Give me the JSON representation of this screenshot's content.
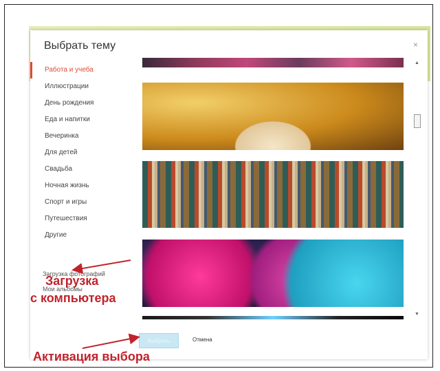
{
  "dialog": {
    "title": "Выбрать тему",
    "close_label": "×"
  },
  "sidebar": {
    "categories": [
      {
        "label": "Работа и учеба",
        "active": true
      },
      {
        "label": "Иллюстрации",
        "active": false
      },
      {
        "label": "День рождения",
        "active": false
      },
      {
        "label": "Еда и напитки",
        "active": false
      },
      {
        "label": "Вечеринка",
        "active": false
      },
      {
        "label": "Для детей",
        "active": false
      },
      {
        "label": "Свадьба",
        "active": false
      },
      {
        "label": "Ночная жизнь",
        "active": false
      },
      {
        "label": "Спорт и игры",
        "active": false
      },
      {
        "label": "Путешествия",
        "active": false
      },
      {
        "label": "Другие",
        "active": false
      }
    ],
    "upload_label": "Загрузка фотографий",
    "albums_label": "Мои альбомы"
  },
  "images": [
    "top-partial-image",
    "open-book-image",
    "paint-brushes-image",
    "lab-flasks-image",
    "bottom-partial-image"
  ],
  "scrollbar": {
    "up_icon": "▲",
    "down_icon": "▼",
    "thumb_label": "≡"
  },
  "footer": {
    "select_label": "Выбрать",
    "cancel_label": "Отмена"
  },
  "annotations": {
    "upload_line1": "Загрузка",
    "upload_line2": "с компьютера",
    "select_caption": "Активация выбора",
    "color": "#c1232c"
  },
  "colors": {
    "active_category": "#dd4b39",
    "select_button_bg": "#c9e8f4"
  }
}
